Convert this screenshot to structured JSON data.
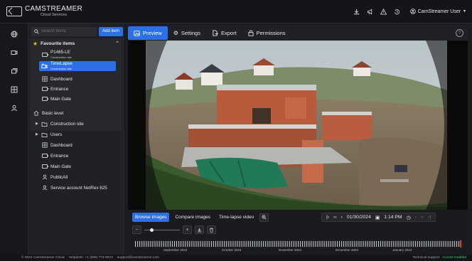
{
  "brand": {
    "name": "CAMSTREAMER",
    "subtitle": "Cloud Services"
  },
  "header": {
    "icons": [
      "download-icon",
      "megaphone-icon",
      "warning-icon",
      "history-icon"
    ],
    "user_label": "CamStreamer User"
  },
  "rail": {
    "icons": [
      "globe-icon",
      "camera-icon",
      "cameras-icon",
      "dashboard-icon",
      "user-icon"
    ]
  },
  "panel": {
    "search_placeholder": "Search items",
    "add_item_label": "Add item",
    "favourites": {
      "title": "Favourite items",
      "items": [
        {
          "label": "P1465-LE",
          "sub": "Construction site",
          "icon": "camera-icon"
        },
        {
          "label": "TimeLapse",
          "sub": "Construction site",
          "icon": "timelapse-icon",
          "selected": true
        },
        {
          "label": "Dashboard",
          "icon": "dashboard-icon"
        },
        {
          "label": "Entrance",
          "icon": "camera-icon"
        },
        {
          "label": "Main Gate",
          "icon": "camera-icon"
        }
      ]
    },
    "tree": [
      {
        "label": "Basic level",
        "icon": "home-icon"
      },
      {
        "label": "Construction site",
        "icon": "folder-icon"
      },
      {
        "label": "Users",
        "icon": "folder-icon"
      },
      {
        "label": "Dashboard",
        "icon": "dashboard-icon"
      },
      {
        "label": "Entrance",
        "icon": "camera-icon"
      },
      {
        "label": "Main Gate",
        "icon": "camera-icon"
      },
      {
        "label": "PublicAll",
        "icon": "user-icon"
      },
      {
        "label": "Service account NetRex 625",
        "icon": "user-icon"
      }
    ]
  },
  "tabs": [
    {
      "label": "Preview",
      "icon": "image-icon",
      "active": true
    },
    {
      "label": "Settings",
      "icon": "gear-icon"
    },
    {
      "label": "Export",
      "icon": "export-icon"
    },
    {
      "label": "Permissions",
      "icon": "lock-icon"
    }
  ],
  "controls": {
    "modes": [
      "Browse images",
      "Compare images",
      "Time-lapse video"
    ],
    "date": "01/30/2024",
    "time": "1:14 PM",
    "zoom_level": 0.18,
    "months": [
      "September 2023",
      "October 2023",
      "November 2023",
      "December 2023",
      "January 2024"
    ]
  },
  "footer": {
    "copyright": "© 2024 CamStreamer Cloud",
    "helpdesk": "Helpdesk: +1 (908) 773-8572",
    "email": "support@camstreamer.com",
    "support_label": "Technical support:",
    "support_status": "Access enabled"
  },
  "colors": {
    "accent": "#2d6fe6",
    "star": "#f2b62a",
    "ok": "#3ecf6a"
  }
}
